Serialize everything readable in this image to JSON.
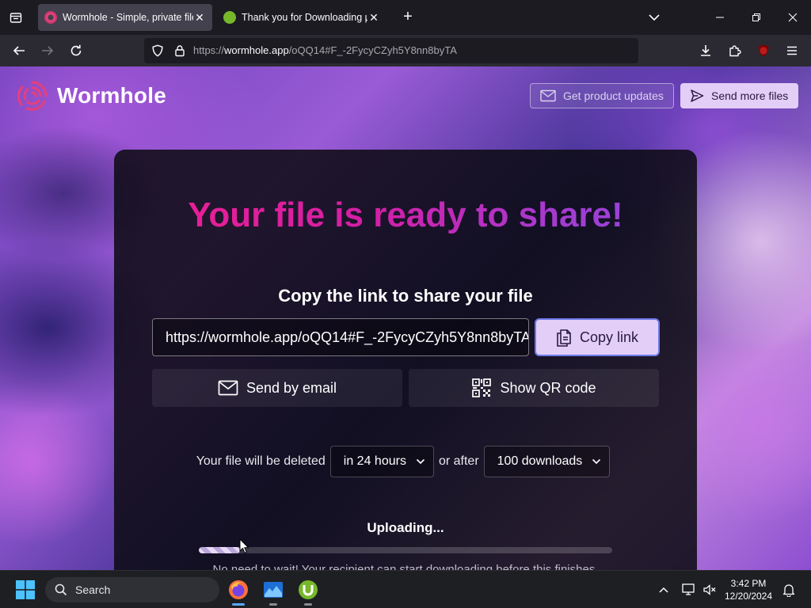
{
  "browser": {
    "tabs": [
      {
        "title": "Wormhole - Simple, private file",
        "active": true
      },
      {
        "title": "Thank you for Downloading µT",
        "active": false
      }
    ],
    "url": {
      "scheme": "https://",
      "host": "wormhole.app",
      "path": "/oQQ14#F_-2FycyCZyh5Y8nn8byTA"
    }
  },
  "site": {
    "brand": "Wormhole",
    "updates_button": "Get product updates",
    "more_button": "Send more files"
  },
  "share": {
    "headline": "Your file is ready to share!",
    "subheading": "Copy the link to share your file",
    "link_value": "https://wormhole.app/oQQ14#F_-2FycyCZyh5Y8nn8byTA",
    "copy_button": "Copy link",
    "email_button": "Send by email",
    "qr_button": "Show QR code",
    "expiry_prefix": "Your file will be deleted",
    "expiry_time": "in 24 hours",
    "expiry_middle": "or after",
    "expiry_downloads": "100 downloads",
    "status": "Uploading...",
    "progress": 0.1,
    "note": "No need to wait! Your recipient can start downloading before this finishes."
  },
  "taskbar": {
    "search_label": "Search",
    "time": "3:42 PM",
    "date": "12/20/2024"
  },
  "colors": {
    "accent": "#e3cef7",
    "headline_start": "#ee1f8f",
    "headline_end": "#8a4be0"
  }
}
